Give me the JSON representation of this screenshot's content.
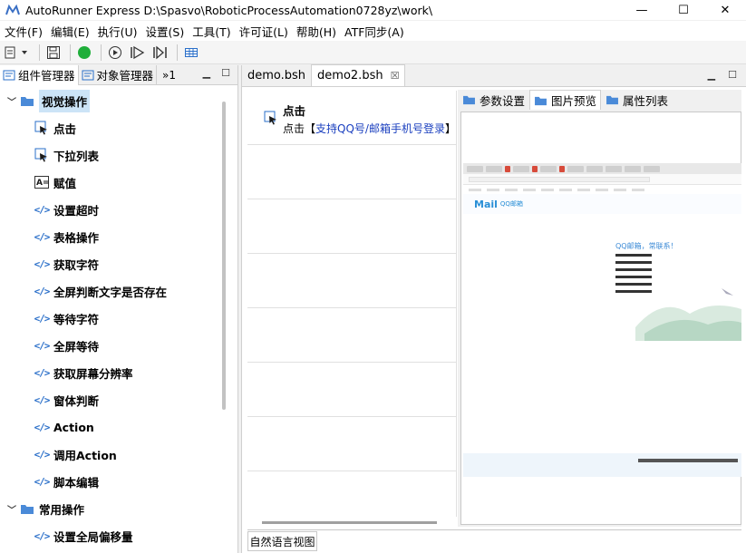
{
  "window": {
    "title": "AutoRunner Express  D:\\Spasvo\\RoboticProcessAutomation0728yz\\work\\",
    "minimize": "—",
    "maximize": "☐",
    "close": "✕"
  },
  "menu": [
    "文件(F)",
    "编辑(E)",
    "执行(U)",
    "设置(S)",
    "工具(T)",
    "许可证(L)",
    "帮助(H)",
    "ATF同步(A)"
  ],
  "left_panel": {
    "tabs": [
      "组件管理器",
      "对象管理器"
    ],
    "overflow": "»1",
    "groups": [
      {
        "label": "视觉操作",
        "expanded": true,
        "selected": true,
        "items": [
          {
            "label": "点击",
            "icon": "cursor-click-icon"
          },
          {
            "label": "下拉列表",
            "icon": "cursor-click-icon"
          },
          {
            "label": "赋值",
            "icon": "assign-icon"
          },
          {
            "label": "设置超时",
            "icon": "code-icon"
          },
          {
            "label": "表格操作",
            "icon": "code-icon"
          },
          {
            "label": "获取字符",
            "icon": "code-icon"
          },
          {
            "label": "全屏判断文字是否存在",
            "icon": "code-icon"
          },
          {
            "label": "等待字符",
            "icon": "code-icon"
          },
          {
            "label": "全屏等待",
            "icon": "code-icon"
          },
          {
            "label": "获取屏幕分辨率",
            "icon": "code-icon"
          },
          {
            "label": "窗体判断",
            "icon": "code-icon"
          },
          {
            "label": "Action",
            "icon": "code-icon"
          },
          {
            "label": "调用Action",
            "icon": "code-icon"
          },
          {
            "label": "脚本编辑",
            "icon": "code-icon"
          }
        ]
      },
      {
        "label": "常用操作",
        "expanded": true,
        "selected": false,
        "items": [
          {
            "label": "设置全局偏移量",
            "icon": "code-icon"
          }
        ]
      }
    ]
  },
  "editor": {
    "tabs": [
      {
        "label": "demo.bsh",
        "active": false
      },
      {
        "label": "demo2.bsh",
        "active": true
      }
    ],
    "close_glyph": "☒",
    "steps": [
      {
        "title": "点击",
        "desc_prefix": "点击【",
        "desc_link": "支持QQ号/邮箱手机号登录",
        "desc_suffix": "】"
      }
    ],
    "empty_rows": 6,
    "bottom_tab": "自然语言视图"
  },
  "preview": {
    "tabs": [
      {
        "label": "参数设置",
        "active": false
      },
      {
        "label": "图片预览",
        "active": true
      },
      {
        "label": "属性列表",
        "active": false
      }
    ],
    "screenshot": {
      "logo": "Mail",
      "logo_sub": "QQ邮箱",
      "greeting": "QQ邮箱，常联系！"
    }
  },
  "colors": {
    "accent_blue": "#2a6fc9",
    "link_blue": "#1a3fbf",
    "run_green": "#1fae3a",
    "selection": "#cce4f7"
  }
}
